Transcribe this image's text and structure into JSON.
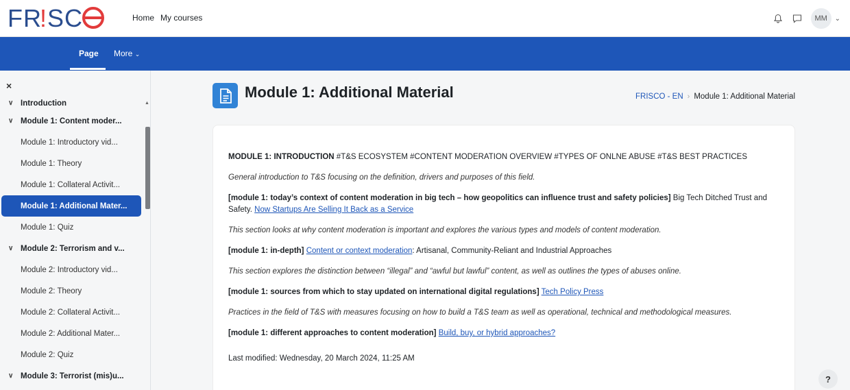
{
  "logo": {
    "text": "FR!SCO",
    "color": "#2a4d8f",
    "accent": "#e23b3b"
  },
  "nav": {
    "home": "Home",
    "my_courses": "My courses"
  },
  "user": {
    "initials": "MM"
  },
  "icons": {
    "notifications": "bell-icon",
    "messages": "chat-icon",
    "help": "question-icon",
    "close": "close-icon",
    "page": "document-icon"
  },
  "secondary_nav": {
    "page": "Page",
    "more": "More"
  },
  "drawer": {
    "close": "×",
    "items": [
      {
        "type": "section",
        "label": "Introduction",
        "cut": true
      },
      {
        "type": "section",
        "label": "Module 1: Content moder..."
      },
      {
        "type": "activity",
        "label": "Module 1: Introductory vid..."
      },
      {
        "type": "activity",
        "label": "Module 1: Theory"
      },
      {
        "type": "activity",
        "label": "Module 1: Collateral Activit..."
      },
      {
        "type": "activity",
        "label": "Module 1: Additional Mater...",
        "active": true
      },
      {
        "type": "activity",
        "label": "Module 1: Quiz"
      },
      {
        "type": "section",
        "label": "Module 2: Terrorism and v..."
      },
      {
        "type": "activity",
        "label": "Module 2: Introductory vid..."
      },
      {
        "type": "activity",
        "label": "Module 2: Theory"
      },
      {
        "type": "activity",
        "label": "Module 2: Collateral Activit..."
      },
      {
        "type": "activity",
        "label": "Module 2: Additional Mater..."
      },
      {
        "type": "activity",
        "label": "Module 2: Quiz"
      },
      {
        "type": "section",
        "label": "Module 3: Terrorist (mis)u..."
      }
    ]
  },
  "page": {
    "title": "Module 1: Additional Material",
    "breadcrumb": {
      "course": "FRISCO - EN",
      "current": "Module 1: Additional Material"
    }
  },
  "content": {
    "p1_bold": "MODULE 1: INTRODUCTION",
    "p1_rest": " #T&S ECOSYSTEM #CONTENT MODERATION OVERVIEW #TYPES OF ONLNE ABUSE #T&S BEST PRACTICES",
    "p2": "General introduction to T&S focusing on the definition, drivers and purposes of this field.",
    "p3_bold": "[module 1: today’s context of content moderation in big tech – how geopolitics can influence trust and safety policies]",
    "p3_text": " Big Tech Ditched Trust and Safety. ",
    "p3_link": "Now Startups Are Selling It Back as a Service",
    "p4": "This section looks at why content moderation is important and explores the various types and models of content moderation.",
    "p5_bold": "[module 1: in-depth]",
    "p5_link": "Content or context moderation",
    "p5_text": ": Artisanal, Community-Reliant and Industrial Approaches",
    "p6": "This section explores the distinction between “illegal” and “awful but lawful” content, as well as outlines the types of abuses online.",
    "p7_bold": "[module 1: sources from which to stay updated on international digital regulations]",
    "p7_link": "Tech Policy Press",
    "p8": "Practices in the field of T&S with measures focusing on how to build a T&S team as well as operational, technical and methodological measures.",
    "p9_bold": "[module 1: different approaches to content moderation]",
    "p9_link": "Build, buy, or hybrid approaches?",
    "last_modified": "Last modified: Wednesday, 20 March 2024, 11:25 AM"
  },
  "help": "?"
}
